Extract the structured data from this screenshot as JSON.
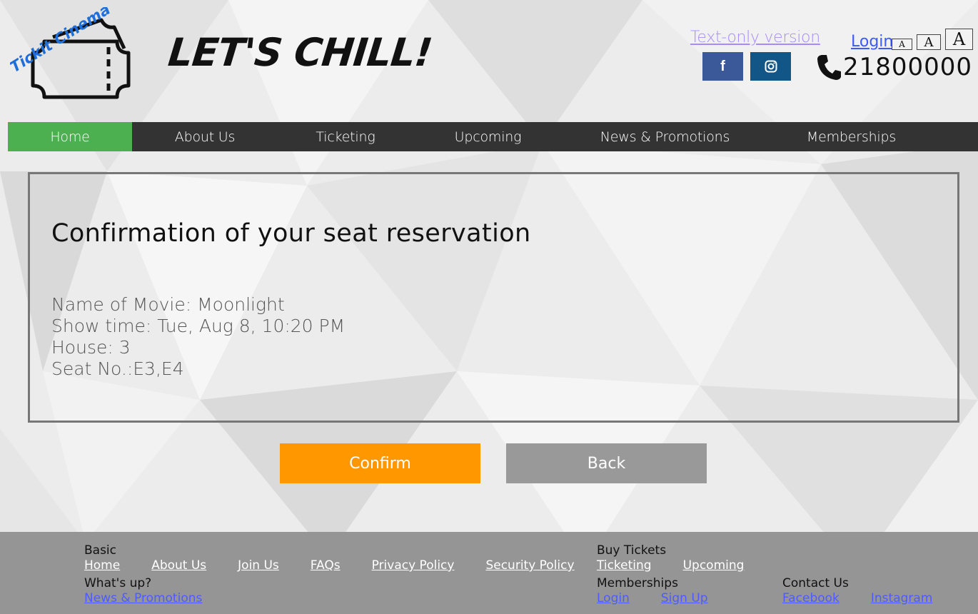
{
  "header": {
    "logo_text": "Tickit Cinema",
    "slogan": "LET'S CHILL!",
    "text_only_link": "Text-only version",
    "login_link": "Login",
    "font_size_buttons": [
      "A",
      "A",
      "A"
    ],
    "social": [
      {
        "label": "f",
        "icon": "facebook-icon",
        "color": "#3b5998"
      },
      {
        "label": "◎",
        "icon": "instagram-icon",
        "color": "#125688"
      }
    ],
    "phone_icon": "phone-icon",
    "phone_number": "21800000"
  },
  "nav": {
    "items": [
      {
        "label": "Home",
        "active": true
      },
      {
        "label": "About Us"
      },
      {
        "label": "Ticketing"
      },
      {
        "label": "Upcoming"
      },
      {
        "label": "News & Promotions"
      },
      {
        "label": "Memberships"
      }
    ],
    "active_color": "#4caf50"
  },
  "confirmation": {
    "title": "Confirmation of your seat reservation",
    "movie": "Name of Movie: Moonlight",
    "showtime": "Show time: Tue, Aug 8, 10:20 PM",
    "house": "House: 3",
    "seats": "Seat No.:E3,E4"
  },
  "actions": {
    "confirm_label": "Confirm",
    "back_label": "Back",
    "confirm_color": "#ff9800"
  },
  "footer": {
    "basic": {
      "heading": "Basic",
      "links": [
        "Home",
        "About Us",
        "Join Us",
        "FAQs",
        "Privacy Policy",
        "Security Policy"
      ]
    },
    "whats_up": {
      "heading": "What's up?",
      "links": [
        "News & Promotions"
      ]
    },
    "buy_tickets": {
      "heading": "Buy Tickets",
      "links": [
        "Ticketing",
        "Upcoming"
      ]
    },
    "memberships": {
      "heading": "Memberships",
      "links": [
        "Login",
        "Sign Up"
      ]
    },
    "contact": {
      "heading": "Contact Us",
      "links": [
        "Facebook",
        "Instagram"
      ]
    }
  }
}
